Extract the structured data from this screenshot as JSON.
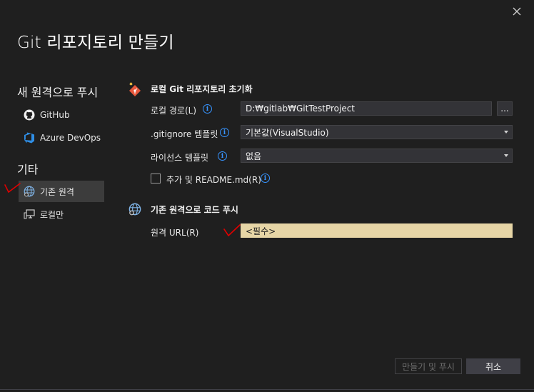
{
  "dialog": {
    "title": "Git 리포지토리 만들기"
  },
  "sidebar": {
    "push_heading": "새 원격으로 푸시",
    "push_items": [
      {
        "label": "GitHub",
        "icon": "github-icon"
      },
      {
        "label": "Azure DevOps",
        "icon": "azure-devops-icon"
      }
    ],
    "other_heading": "기타",
    "other_items": [
      {
        "label": "기존 원격",
        "icon": "globe-icon",
        "selected": true
      },
      {
        "label": "로컬만",
        "icon": "computer-icon",
        "selected": false
      }
    ]
  },
  "init_section": {
    "heading": "로컬 Git 리포지토리 초기화",
    "local_path_label": "로컬 경로(L)",
    "local_path_value": "D:₩gitlab₩GitTestProject",
    "browse_label": "...",
    "gitignore_label": ".gitignore 템플릿",
    "gitignore_value": "기본값(VisualStudio)",
    "license_label": "라이선스 템플릿",
    "license_value": "없음",
    "readme_label": "추가 및 README.md(R)",
    "readme_checked": false
  },
  "push_section": {
    "heading": "기존 원격으로 코드 푸시",
    "remote_url_label": "원격 URL(R)",
    "remote_url_placeholder": "<필수>"
  },
  "footer": {
    "create_push_label": "만들기 및 푸시",
    "cancel_label": "취소"
  },
  "colors": {
    "background": "#1f1f1f",
    "selected_nav": "#3c3c3c",
    "required_field": "#e6d5a6",
    "info_blue": "#3794ff",
    "annotation_red": "#e00000"
  }
}
